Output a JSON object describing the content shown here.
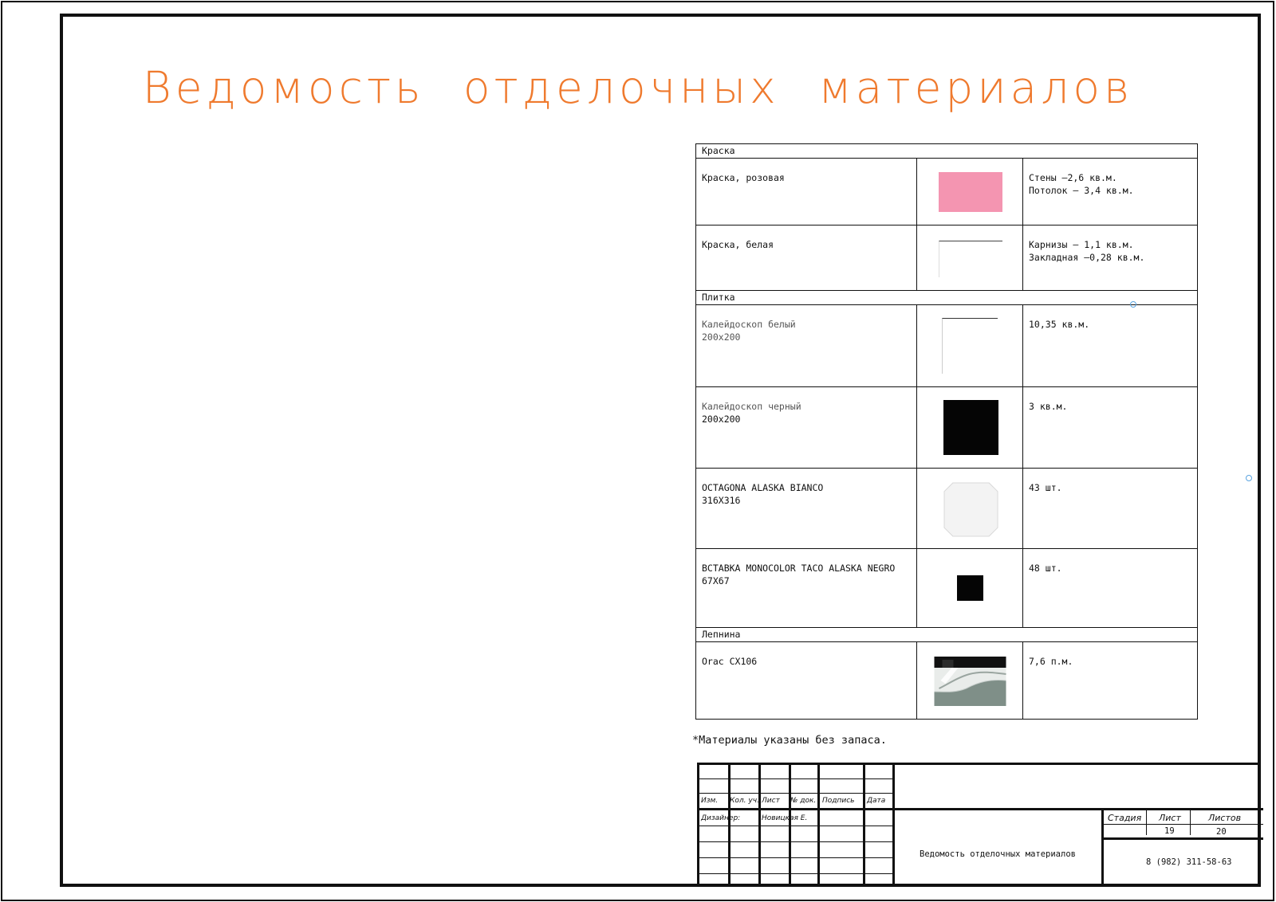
{
  "title": "Ведомость отделочных материалов",
  "sections": {
    "paint": "Краска",
    "tile": "Плитка",
    "moulding": "Лепнина"
  },
  "rows": [
    {
      "name_1": "Краска, розовая",
      "name_2": "",
      "qty_1": "Стены –2,6 кв.м.",
      "qty_2": "Потолок – 3,4 кв.м.",
      "swatch_color": "#f495b1"
    },
    {
      "name_1": "Краска, белая",
      "name_2": "",
      "qty_1": "Карнизы – 1,1 кв.м.",
      "qty_2": "Закладная –0,28 кв.м.",
      "swatch_color": "#ffffff"
    },
    {
      "name_1": "Калейдоскоп белый",
      "name_2": "200x200",
      "qty_1": "10,35 кв.м.",
      "qty_2": "",
      "swatch_color": "#ffffff"
    },
    {
      "name_1": "Калейдоскоп черный",
      "name_2": "200x200",
      "qty_1": "3 кв.м.",
      "qty_2": "",
      "swatch_color": "#050505"
    },
    {
      "name_1": "OCTAGONA ALASKA BIANCO",
      "name_2": "316X316",
      "qty_1": "43 шт.",
      "qty_2": "",
      "swatch_color": "#f2f2f2"
    },
    {
      "name_1": "ВСТАВКА MONOCOLOR TACO ALASKA NEGRO",
      "name_2": "67X67",
      "qty_1": "48 шт.",
      "qty_2": "",
      "swatch_color": "#050505"
    },
    {
      "name_1": "Orac CX106",
      "name_2": "",
      "qty_1": "7,6 п.м.",
      "qty_2": "",
      "swatch_color": "#7d8c85"
    }
  ],
  "note": "*Материалы указаны без запаса.",
  "title_block": {
    "col_izm": "Изм.",
    "col_kol": "Кол. уч.",
    "col_list": "Лист",
    "col_ndok": "№ док.",
    "col_podpis": "Подпись",
    "col_data": "Дата",
    "designer_label": "Дизайнер:",
    "designer_name": "Новицкая Е.",
    "sheet_title": "Ведомость отделочных материалов",
    "stage_label": "Стадия",
    "sheet_label": "Лист",
    "sheets_label": "Листов",
    "stage_value": "",
    "sheet_value": "19",
    "sheets_value": "20",
    "phone": "8 (982) 311-58-63"
  },
  "colors": {
    "title": "#ef7a2e",
    "pink_paint": "#f495b1",
    "marker": "#5aa4e0"
  }
}
